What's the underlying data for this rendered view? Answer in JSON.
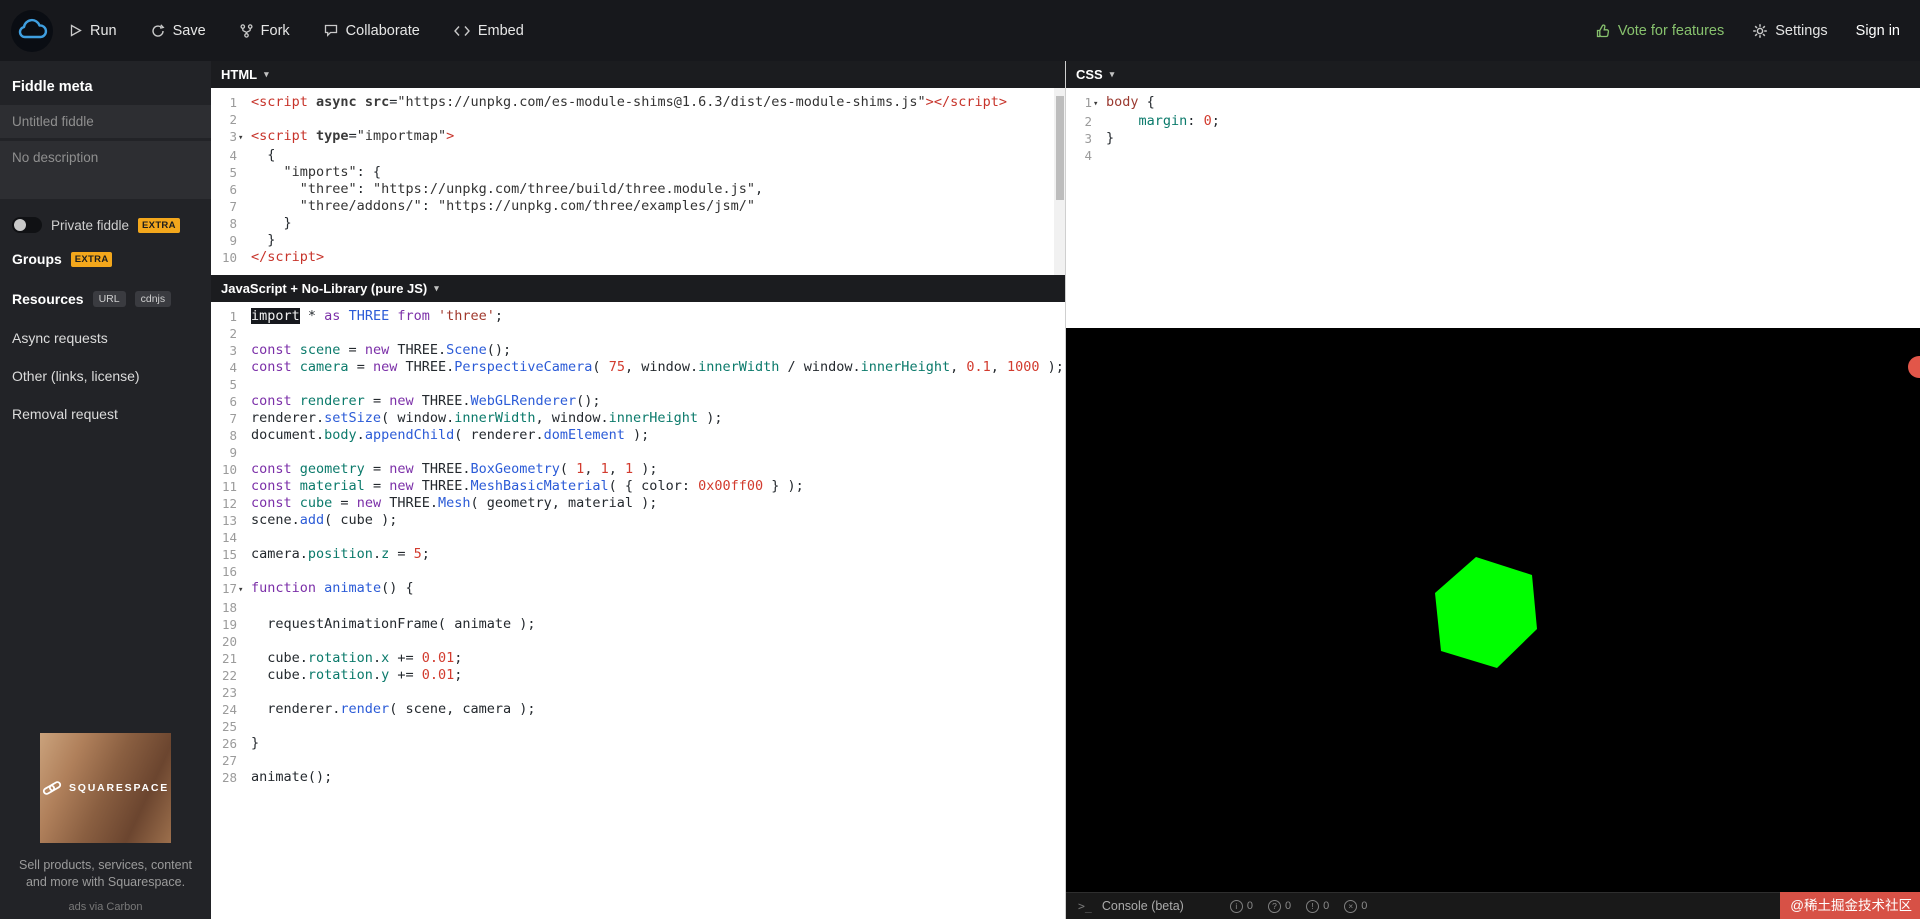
{
  "topbar": {
    "buttons": [
      {
        "label": "Run"
      },
      {
        "label": "Save"
      },
      {
        "label": "Fork"
      },
      {
        "label": "Collaborate"
      },
      {
        "label": "Embed"
      }
    ],
    "vote_label": "Vote for features",
    "settings_label": "Settings",
    "signin_label": "Sign in"
  },
  "sidebar": {
    "heading": "Fiddle meta",
    "title_placeholder": "Untitled fiddle",
    "description_placeholder": "No description",
    "private_label": "Private fiddle",
    "extra_badge": "EXTRA",
    "groups_label": "Groups",
    "resources_label": "Resources",
    "resources_badges": [
      "URL",
      "cdnjs"
    ],
    "links": [
      "Async requests",
      "Other (links, license)",
      "Removal request"
    ],
    "ad": {
      "brand": "SQUARESPACE",
      "text": "Sell products, services, content and more with Squarespace.",
      "attribution": "ads via Carbon"
    }
  },
  "editors": {
    "html": {
      "title": "HTML",
      "lines": [
        {
          "n": 1,
          "t": [
            [
              "<script",
              "tag"
            ],
            [
              " ",
              "pln"
            ],
            [
              "async",
              "attr"
            ],
            [
              " ",
              "pln"
            ],
            [
              "src",
              "attr"
            ],
            [
              "=",
              "pln"
            ],
            [
              "\"https://unpkg.com/es-module-shims@1.6.3/dist/es-module-shims.js\"",
              "hstr"
            ],
            [
              ">",
              "tag"
            ],
            [
              "</script>",
              "tag"
            ]
          ]
        },
        {
          "n": 2,
          "t": []
        },
        {
          "n": 3,
          "fold": true,
          "t": [
            [
              "<script",
              "tag"
            ],
            [
              " ",
              "pln"
            ],
            [
              "type",
              "attr"
            ],
            [
              "=",
              "pln"
            ],
            [
              "\"importmap\"",
              "hstr"
            ],
            [
              ">",
              "tag"
            ]
          ]
        },
        {
          "n": 4,
          "t": [
            [
              "  {",
              "pln"
            ]
          ]
        },
        {
          "n": 5,
          "t": [
            [
              "    ",
              "pln"
            ],
            [
              "\"imports\"",
              "hstr"
            ],
            [
              ": {",
              "pln"
            ]
          ]
        },
        {
          "n": 6,
          "t": [
            [
              "      ",
              "pln"
            ],
            [
              "\"three\"",
              "hstr"
            ],
            [
              ": ",
              "pln"
            ],
            [
              "\"https://unpkg.com/three/build/three.module.js\"",
              "hstr"
            ],
            [
              ",",
              "pln"
            ]
          ]
        },
        {
          "n": 7,
          "t": [
            [
              "      ",
              "pln"
            ],
            [
              "\"three/addons/\"",
              "hstr"
            ],
            [
              ": ",
              "pln"
            ],
            [
              "\"https://unpkg.com/three/examples/jsm/\"",
              "hstr"
            ]
          ]
        },
        {
          "n": 8,
          "t": [
            [
              "    }",
              "pln"
            ]
          ]
        },
        {
          "n": 9,
          "t": [
            [
              "  }",
              "pln"
            ]
          ]
        },
        {
          "n": 10,
          "t": [
            [
              "</script>",
              "tag"
            ]
          ]
        }
      ]
    },
    "js": {
      "title": "JavaScript + No-Library (pure JS)",
      "lines": [
        {
          "n": 1,
          "t": [
            [
              "import",
              "selkw"
            ],
            [
              " * ",
              "pln"
            ],
            [
              "as",
              "kw"
            ],
            [
              " ",
              "pln"
            ],
            [
              "THREE",
              "fn"
            ],
            [
              " ",
              "pln"
            ],
            [
              "from",
              "kw"
            ],
            [
              " ",
              "pln"
            ],
            [
              "'three'",
              "str"
            ],
            [
              ";",
              "pln"
            ]
          ]
        },
        {
          "n": 2,
          "t": []
        },
        {
          "n": 3,
          "t": [
            [
              "const",
              "kw"
            ],
            [
              " ",
              "pln"
            ],
            [
              "scene",
              "def"
            ],
            [
              " = ",
              "pln"
            ],
            [
              "new",
              "kw"
            ],
            [
              " THREE.",
              "pln"
            ],
            [
              "Scene",
              "fn"
            ],
            [
              "();",
              "pln"
            ]
          ]
        },
        {
          "n": 4,
          "t": [
            [
              "const",
              "kw"
            ],
            [
              " ",
              "pln"
            ],
            [
              "camera",
              "def"
            ],
            [
              " = ",
              "pln"
            ],
            [
              "new",
              "kw"
            ],
            [
              " THREE.",
              "pln"
            ],
            [
              "PerspectiveCamera",
              "fn"
            ],
            [
              "( ",
              "pln"
            ],
            [
              "75",
              "num"
            ],
            [
              ", window.",
              "pln"
            ],
            [
              "innerWidth",
              "def"
            ],
            [
              " / window.",
              "pln"
            ],
            [
              "innerHeight",
              "def"
            ],
            [
              ", ",
              "pln"
            ],
            [
              "0.1",
              "num"
            ],
            [
              ", ",
              "pln"
            ],
            [
              "1000",
              "num"
            ],
            [
              " );",
              "pln"
            ]
          ]
        },
        {
          "n": 5,
          "t": []
        },
        {
          "n": 6,
          "t": [
            [
              "const",
              "kw"
            ],
            [
              " ",
              "pln"
            ],
            [
              "renderer",
              "def"
            ],
            [
              " = ",
              "pln"
            ],
            [
              "new",
              "kw"
            ],
            [
              " THREE.",
              "pln"
            ],
            [
              "WebGLRenderer",
              "fn"
            ],
            [
              "();",
              "pln"
            ]
          ]
        },
        {
          "n": 7,
          "t": [
            [
              "renderer.",
              "pln"
            ],
            [
              "setSize",
              "fn"
            ],
            [
              "( window.",
              "pln"
            ],
            [
              "innerWidth",
              "def"
            ],
            [
              ", window.",
              "pln"
            ],
            [
              "innerHeight",
              "def"
            ],
            [
              " );",
              "pln"
            ]
          ]
        },
        {
          "n": 8,
          "t": [
            [
              "document.",
              "pln"
            ],
            [
              "body",
              "def"
            ],
            [
              ".",
              "pln"
            ],
            [
              "appendChild",
              "fn"
            ],
            [
              "( renderer.",
              "pln"
            ],
            [
              "domElement",
              "fn"
            ],
            [
              " );",
              "pln"
            ]
          ]
        },
        {
          "n": 9,
          "t": []
        },
        {
          "n": 10,
          "t": [
            [
              "const",
              "kw"
            ],
            [
              " ",
              "pln"
            ],
            [
              "geometry",
              "def"
            ],
            [
              " = ",
              "pln"
            ],
            [
              "new",
              "kw"
            ],
            [
              " THREE.",
              "pln"
            ],
            [
              "BoxGeometry",
              "fn"
            ],
            [
              "( ",
              "pln"
            ],
            [
              "1",
              "num"
            ],
            [
              ", ",
              "pln"
            ],
            [
              "1",
              "num"
            ],
            [
              ", ",
              "pln"
            ],
            [
              "1",
              "num"
            ],
            [
              " );",
              "pln"
            ]
          ]
        },
        {
          "n": 11,
          "t": [
            [
              "const",
              "kw"
            ],
            [
              " ",
              "pln"
            ],
            [
              "material",
              "def"
            ],
            [
              " = ",
              "pln"
            ],
            [
              "new",
              "kw"
            ],
            [
              " THREE.",
              "pln"
            ],
            [
              "MeshBasicMaterial",
              "fn"
            ],
            [
              "( { color: ",
              "pln"
            ],
            [
              "0x00ff00",
              "num"
            ],
            [
              " } );",
              "pln"
            ]
          ]
        },
        {
          "n": 12,
          "t": [
            [
              "const",
              "kw"
            ],
            [
              " ",
              "pln"
            ],
            [
              "cube",
              "def"
            ],
            [
              " = ",
              "pln"
            ],
            [
              "new",
              "kw"
            ],
            [
              " THREE.",
              "pln"
            ],
            [
              "Mesh",
              "fn"
            ],
            [
              "( geometry, material );",
              "pln"
            ]
          ]
        },
        {
          "n": 13,
          "t": [
            [
              "scene.",
              "pln"
            ],
            [
              "add",
              "fn"
            ],
            [
              "( cube );",
              "pln"
            ]
          ]
        },
        {
          "n": 14,
          "t": []
        },
        {
          "n": 15,
          "t": [
            [
              "camera.",
              "pln"
            ],
            [
              "position",
              "def"
            ],
            [
              ".",
              "pln"
            ],
            [
              "z",
              "def"
            ],
            [
              " = ",
              "pln"
            ],
            [
              "5",
              "num"
            ],
            [
              ";",
              "pln"
            ]
          ]
        },
        {
          "n": 16,
          "t": []
        },
        {
          "n": 17,
          "fold": true,
          "t": [
            [
              "function",
              "kw"
            ],
            [
              " ",
              "pln"
            ],
            [
              "animate",
              "fn"
            ],
            [
              "() {",
              "pln"
            ]
          ]
        },
        {
          "n": 18,
          "t": []
        },
        {
          "n": 19,
          "t": [
            [
              "  requestAnimationFrame( animate );",
              "pln"
            ]
          ]
        },
        {
          "n": 20,
          "t": []
        },
        {
          "n": 21,
          "t": [
            [
              "  cube.",
              "pln"
            ],
            [
              "rotation",
              "def"
            ],
            [
              ".",
              "pln"
            ],
            [
              "x",
              "def"
            ],
            [
              " += ",
              "pln"
            ],
            [
              "0.01",
              "num"
            ],
            [
              ";",
              "pln"
            ]
          ]
        },
        {
          "n": 22,
          "t": [
            [
              "  cube.",
              "pln"
            ],
            [
              "rotation",
              "def"
            ],
            [
              ".",
              "pln"
            ],
            [
              "y",
              "def"
            ],
            [
              " += ",
              "pln"
            ],
            [
              "0.01",
              "num"
            ],
            [
              ";",
              "pln"
            ]
          ]
        },
        {
          "n": 23,
          "t": []
        },
        {
          "n": 24,
          "t": [
            [
              "  renderer.",
              "pln"
            ],
            [
              "render",
              "fn"
            ],
            [
              "( scene, camera );",
              "pln"
            ]
          ]
        },
        {
          "n": 25,
          "t": []
        },
        {
          "n": 26,
          "t": [
            [
              "}",
              "pln"
            ]
          ]
        },
        {
          "n": 27,
          "t": []
        },
        {
          "n": 28,
          "t": [
            [
              "animate();",
              "pln"
            ]
          ]
        }
      ]
    },
    "css": {
      "title": "CSS",
      "lines": [
        {
          "n": 1,
          "fold": true,
          "t": [
            [
              "body",
              "csel"
            ],
            [
              " {",
              "pln"
            ]
          ]
        },
        {
          "n": 2,
          "t": [
            [
              "    ",
              "pln"
            ],
            [
              "margin",
              "def"
            ],
            [
              ": ",
              "pln"
            ],
            [
              "0",
              "num"
            ],
            [
              ";",
              "pln"
            ]
          ]
        },
        {
          "n": 3,
          "t": [
            [
              "}",
              "pln"
            ]
          ]
        },
        {
          "n": 4,
          "t": []
        }
      ]
    }
  },
  "result": {
    "cube_color": "#00ff00",
    "console": {
      "prompt": ">_",
      "label": "Console (beta)",
      "counters": [
        {
          "icon": "info",
          "count": "0"
        },
        {
          "icon": "question",
          "count": "0"
        },
        {
          "icon": "warning",
          "count": "0"
        },
        {
          "icon": "error",
          "count": "0"
        }
      ]
    },
    "watermark": "@稀土掘金技术社区"
  }
}
